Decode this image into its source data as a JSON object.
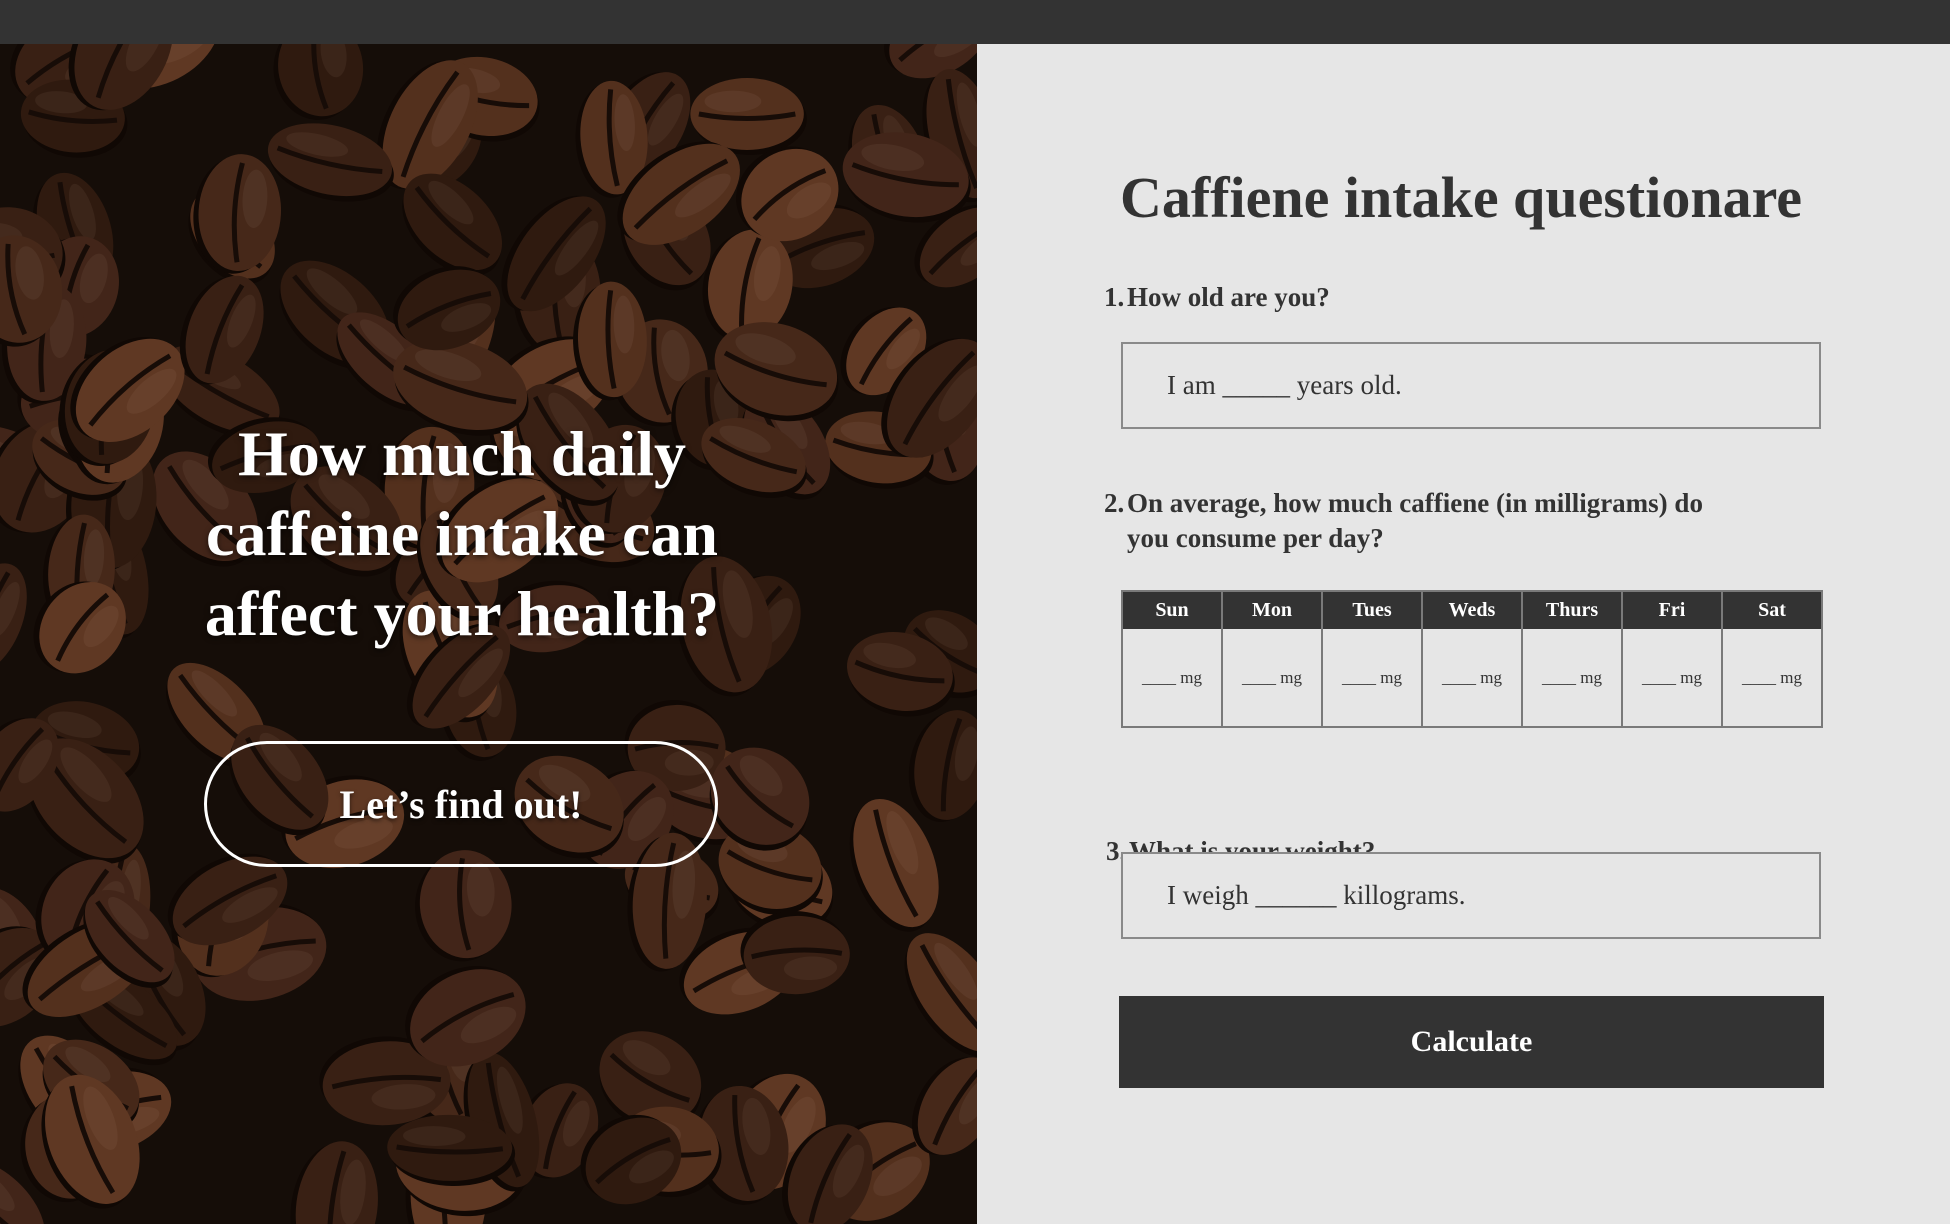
{
  "hero": {
    "title_line1": "How much daily",
    "title_line2": "caffeine intake can",
    "title_line3": "affect your health?",
    "cta_label": "Let’s find out!",
    "image": "coffee-beans-photo"
  },
  "form": {
    "title": "Caffiene intake questionare",
    "q1": {
      "number": "1.",
      "text": "How old are you?",
      "answer": "I am _____ years old."
    },
    "q2": {
      "number": "2.",
      "text_line1": "On average, how much caffiene (in milligrams) do",
      "text_line2": "you consume per day?",
      "days": [
        {
          "label": "Sun",
          "value": "____ mg"
        },
        {
          "label": "Mon",
          "value": "____ mg"
        },
        {
          "label": "Tues",
          "value": "____ mg"
        },
        {
          "label": "Weds",
          "value": "____ mg"
        },
        {
          "label": "Thurs",
          "value": "____ mg"
        },
        {
          "label": "Fri",
          "value": "____ mg"
        },
        {
          "label": "Sat",
          "value": "____ mg"
        }
      ]
    },
    "q3": {
      "number": "3.",
      "text": "What is your weight?",
      "answer": "I weigh ______ killograms."
    },
    "calculate_label": "Calculate"
  },
  "colors": {
    "topbar": "#333333",
    "panel_bg": "#e6e6e6",
    "text": "#333333",
    "button_bg": "#333333",
    "bean": "#5a3421"
  }
}
